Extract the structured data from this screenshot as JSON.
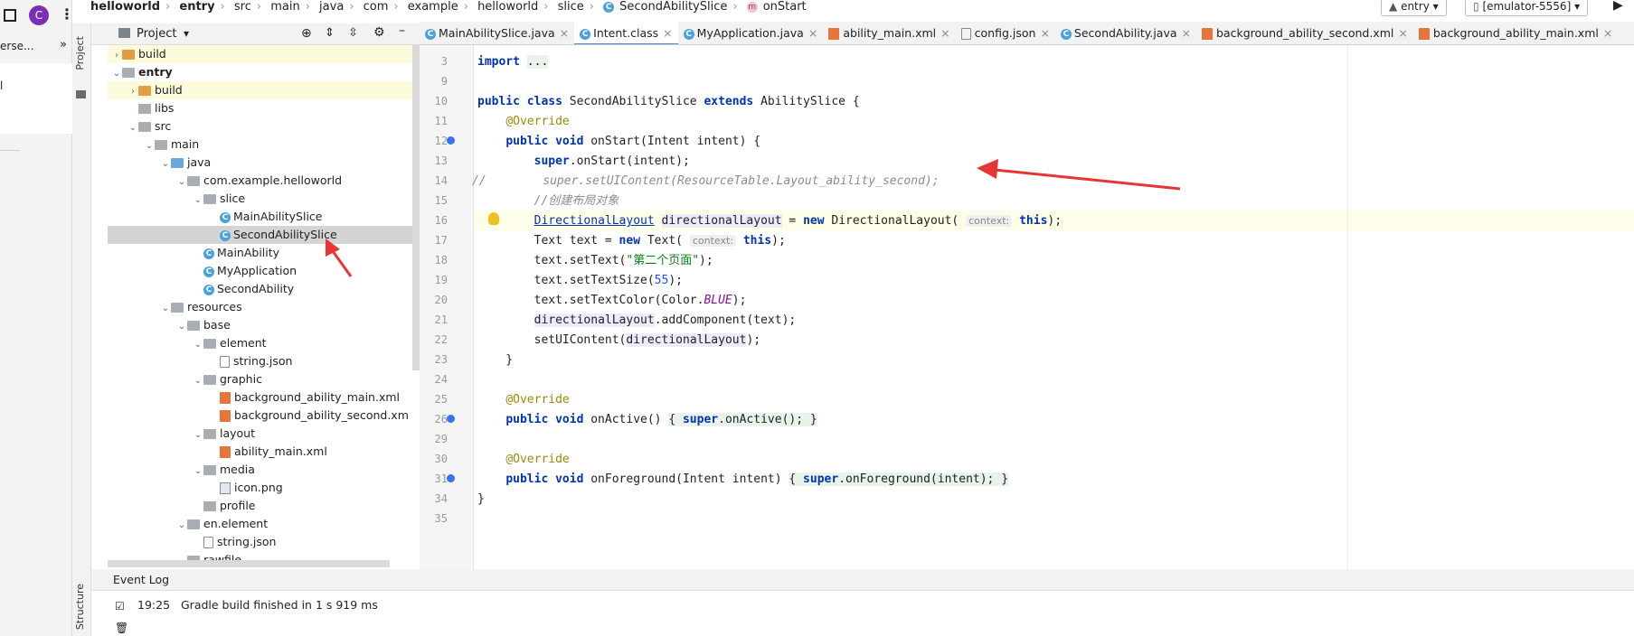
{
  "browser_strip": {
    "avatar_letter": "C",
    "snippet_1": "erse...",
    "snippet_2": "»",
    "snippet_3": "l",
    "snippet_4": "▲"
  },
  "breadcrumb": [
    "helloworld",
    "entry",
    "src",
    "main",
    "java",
    "com",
    "example",
    "helloworld",
    "slice",
    "SecondAbilitySlice",
    "onStart"
  ],
  "run_config": {
    "module": "entry",
    "device": "[emulator-5556]"
  },
  "project_panel": {
    "title": "Project",
    "tree": [
      {
        "label": "build",
        "depth": 0,
        "type": "folder-orange",
        "chev": "›",
        "hl": true
      },
      {
        "label": "entry",
        "depth": 0,
        "type": "folder",
        "chev": "⌄",
        "bold": true
      },
      {
        "label": "build",
        "depth": 1,
        "type": "folder-orange",
        "chev": "›",
        "hl": true
      },
      {
        "label": "libs",
        "depth": 1,
        "type": "folder",
        "chev": ""
      },
      {
        "label": "src",
        "depth": 1,
        "type": "folder",
        "chev": "⌄"
      },
      {
        "label": "main",
        "depth": 2,
        "type": "folder",
        "chev": "⌄"
      },
      {
        "label": "java",
        "depth": 3,
        "type": "folder-blue",
        "chev": "⌄"
      },
      {
        "label": "com.example.helloworld",
        "depth": 4,
        "type": "folder",
        "chev": "⌄"
      },
      {
        "label": "slice",
        "depth": 5,
        "type": "folder",
        "chev": "⌄"
      },
      {
        "label": "MainAbilitySlice",
        "depth": 6,
        "type": "class",
        "chev": ""
      },
      {
        "label": "SecondAbilitySlice",
        "depth": 6,
        "type": "class",
        "chev": "",
        "sel": true
      },
      {
        "label": "MainAbility",
        "depth": 5,
        "type": "class",
        "chev": ""
      },
      {
        "label": "MyApplication",
        "depth": 5,
        "type": "class",
        "chev": ""
      },
      {
        "label": "SecondAbility",
        "depth": 5,
        "type": "class",
        "chev": ""
      },
      {
        "label": "resources",
        "depth": 3,
        "type": "folder",
        "chev": "⌄"
      },
      {
        "label": "base",
        "depth": 4,
        "type": "folder",
        "chev": "⌄"
      },
      {
        "label": "element",
        "depth": 5,
        "type": "folder",
        "chev": "⌄"
      },
      {
        "label": "string.json",
        "depth": 6,
        "type": "json",
        "chev": ""
      },
      {
        "label": "graphic",
        "depth": 5,
        "type": "folder",
        "chev": "⌄"
      },
      {
        "label": "background_ability_main.xml",
        "depth": 6,
        "type": "xml",
        "chev": ""
      },
      {
        "label": "background_ability_second.xm",
        "depth": 6,
        "type": "xml",
        "chev": ""
      },
      {
        "label": "layout",
        "depth": 5,
        "type": "folder",
        "chev": "⌄"
      },
      {
        "label": "ability_main.xml",
        "depth": 6,
        "type": "xml",
        "chev": ""
      },
      {
        "label": "media",
        "depth": 5,
        "type": "folder",
        "chev": "⌄"
      },
      {
        "label": "icon.png",
        "depth": 6,
        "type": "png",
        "chev": ""
      },
      {
        "label": "profile",
        "depth": 5,
        "type": "folder",
        "chev": ""
      },
      {
        "label": "en.element",
        "depth": 4,
        "type": "folder",
        "chev": "⌄"
      },
      {
        "label": "string.json",
        "depth": 5,
        "type": "json",
        "chev": ""
      },
      {
        "label": "rawfile",
        "depth": 4,
        "type": "folder",
        "chev": ""
      }
    ]
  },
  "side_tabs": {
    "project": "Project",
    "structure": "Structure"
  },
  "editor_tabs": [
    {
      "label": "MainAbilitySlice.java",
      "icon": "class"
    },
    {
      "label": "Intent.class",
      "icon": "class",
      "active": true
    },
    {
      "label": "MyApplication.java",
      "icon": "class"
    },
    {
      "label": "ability_main.xml",
      "icon": "xml"
    },
    {
      "label": "config.json",
      "icon": "json"
    },
    {
      "label": "SecondAbility.java",
      "icon": "class"
    },
    {
      "label": "background_ability_second.xml",
      "icon": "xml"
    },
    {
      "label": "background_ability_main.xml",
      "icon": "xml"
    }
  ],
  "line_numbers": [
    "3",
    "9",
    "10",
    "11",
    "12",
    "13",
    "14",
    "15",
    "16",
    "17",
    "18",
    "19",
    "20",
    "21",
    "22",
    "23",
    "24",
    "25",
    "26",
    "29",
    "30",
    "31",
    "34",
    "35"
  ],
  "event_log": {
    "title": "Event Log",
    "time": "19:25",
    "message": "Gradle build finished in 1 s 919 ms"
  },
  "colors": {
    "arrow": "#e53535",
    "selection": "#d4d4d4",
    "current_line": "#fefee8"
  }
}
